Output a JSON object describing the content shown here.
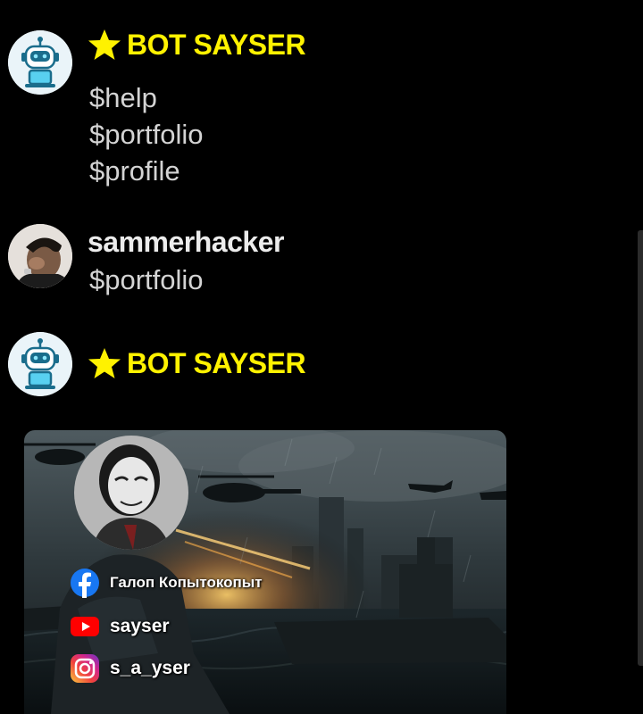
{
  "messages": [
    {
      "author": "BOT SAYSER",
      "author_icon": "star-icon",
      "avatar": "robot-avatar",
      "lines": [
        "$help",
        "$portfolio",
        "$profile"
      ]
    },
    {
      "author": "sammerhacker",
      "avatar": "user-photo-avatar",
      "lines": [
        "$portfolio"
      ]
    },
    {
      "author": "BOT SAYSER",
      "author_icon": "star-icon",
      "avatar": "robot-avatar",
      "attachment": {
        "type": "image-card",
        "socials": [
          {
            "icon": "facebook-icon",
            "text": "Галоп Копытокопыт"
          },
          {
            "icon": "youtube-icon",
            "text": "sayser"
          },
          {
            "icon": "instagram-icon",
            "text": "s_a_yser"
          }
        ]
      }
    }
  ],
  "colors": {
    "background": "#000000",
    "bot_name": "#fff200",
    "user_name": "#ececec",
    "message_text": "#d4d4d4"
  }
}
